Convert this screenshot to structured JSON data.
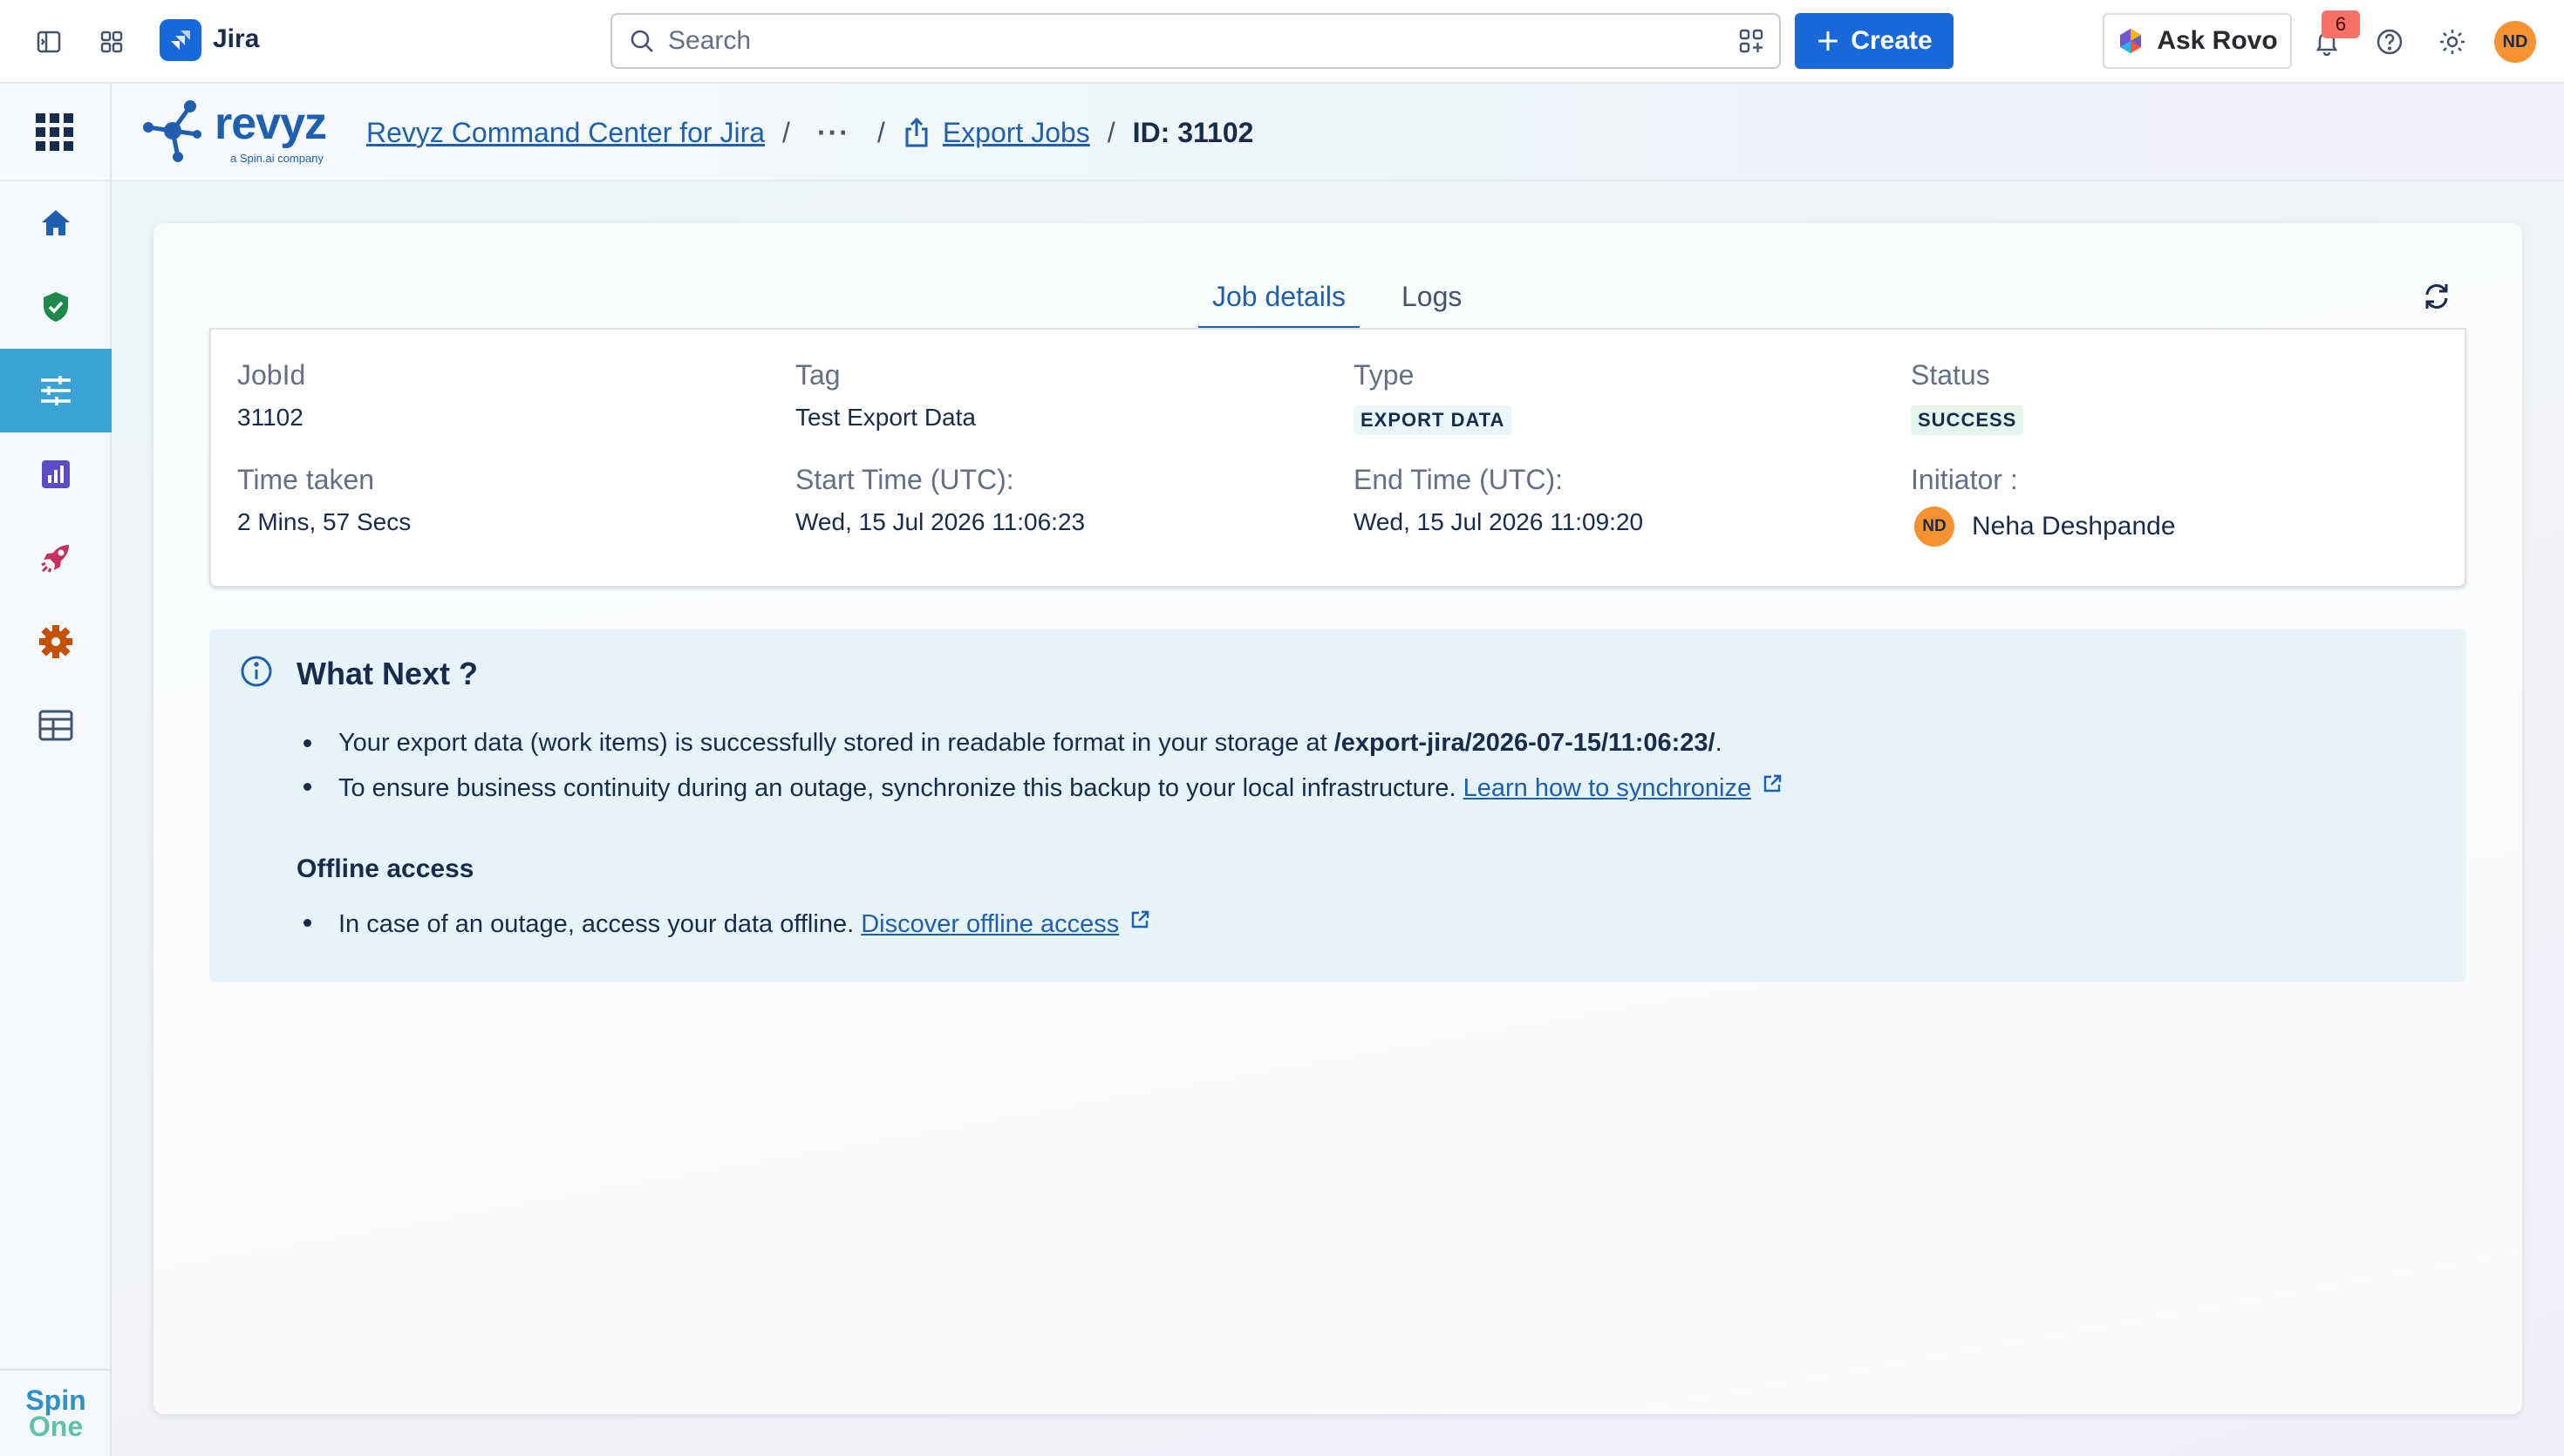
{
  "topbar": {
    "app_name": "Jira",
    "search_placeholder": "Search",
    "create_label": "Create",
    "rovo_label": "Ask Rovo",
    "notification_count": "6",
    "user_initials": "ND"
  },
  "app_header": {
    "brand_name": "revyz",
    "brand_sub": "a Spin.ai company",
    "breadcrumbs": {
      "root": "Revyz Command Center for Jira",
      "more": "···",
      "export_jobs": "Export Jobs",
      "current": "ID: 31102",
      "separator": "/"
    }
  },
  "sidebar": {
    "items": [
      {
        "name": "home",
        "icon": "home-icon"
      },
      {
        "name": "protection",
        "icon": "shield-check-icon"
      },
      {
        "name": "settings-sliders",
        "icon": "sliders-icon",
        "active": true
      },
      {
        "name": "reports",
        "icon": "chart-icon"
      },
      {
        "name": "launch",
        "icon": "rocket-icon"
      },
      {
        "name": "config",
        "icon": "gear-icon"
      },
      {
        "name": "table",
        "icon": "table-icon"
      }
    ],
    "footer_logo": {
      "line1": "Spin",
      "line2": "One"
    }
  },
  "tabs": [
    {
      "label": "Job details",
      "active": true
    },
    {
      "label": "Logs",
      "active": false
    }
  ],
  "job": {
    "jobid_label": "JobId",
    "jobid_value": "31102",
    "tag_label": "Tag",
    "tag_value": "Test Export Data",
    "type_label": "Type",
    "type_value": "EXPORT DATA",
    "status_label": "Status",
    "status_value": "SUCCESS",
    "time_label": "Time taken",
    "time_value": "2 Mins, 57 Secs",
    "start_label": "Start Time (UTC):",
    "start_value": "Wed, 15 Jul 2026 11:06:23",
    "end_label": "End Time (UTC):",
    "end_value": "Wed, 15 Jul 2026 11:09:20",
    "initiator_label": "Initiator :",
    "initiator_initials": "ND",
    "initiator_name": "Neha Deshpande"
  },
  "what_next": {
    "title": "What Next ?",
    "bullet1_prefix": "Your export data (work items) is successfully stored in readable format in your storage at ",
    "bullet1_path": "/export-jira/2026-07-15/11:06:23/",
    "bullet1_suffix": ".",
    "bullet2_text": "To ensure business continuity during an outage, synchronize this backup to your local infrastructure. ",
    "bullet2_link": "Learn how to synchronize",
    "offline_title": "Offline access",
    "bullet3_text": "In case of an outage, access your data offline. ",
    "bullet3_link": "Discover offline access"
  },
  "colors": {
    "primary": "#1868db",
    "link": "#1f5fb0",
    "sidebar_active": "#3aa3d6",
    "info_bg": "#e6f4fa",
    "avatar": "#f79232"
  }
}
